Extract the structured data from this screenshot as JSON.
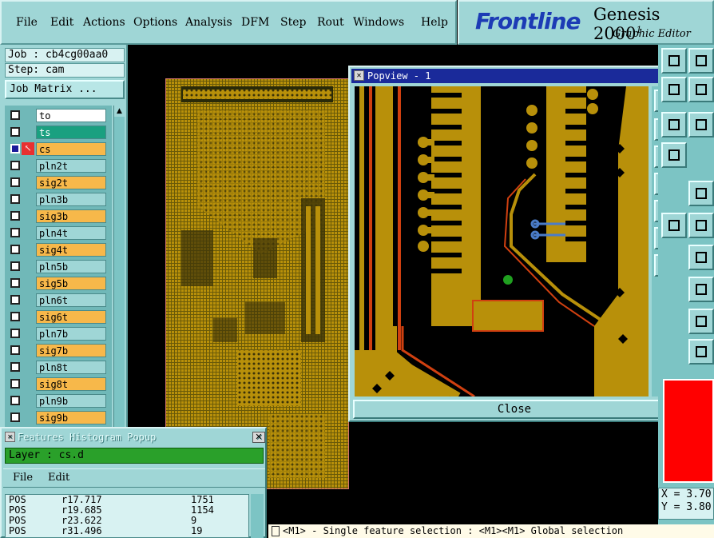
{
  "menubar": {
    "items": [
      "File",
      "Edit",
      "Actions",
      "Options",
      "Analysis",
      "DFM",
      "Step",
      "Rout",
      "Windows",
      "Help"
    ]
  },
  "logo": {
    "brand": "Frontline",
    "product": "Genesis 2000",
    "version_mark": "1",
    "subtitle": "Graphic Editor"
  },
  "job": {
    "job_label": "Job : cb4cg00aa0",
    "step_label": "Step: cam",
    "matrix_button": "Job Matrix ..."
  },
  "layers": [
    {
      "name": "to",
      "type": "to",
      "checked": false,
      "arrow": false
    },
    {
      "name": "ts",
      "type": "ts",
      "checked": false,
      "arrow": false
    },
    {
      "name": "cs",
      "type": "cs",
      "checked": true,
      "arrow": true
    },
    {
      "name": "pln2t",
      "type": "pln",
      "checked": false,
      "arrow": false
    },
    {
      "name": "sig2t",
      "type": "sig",
      "checked": false,
      "arrow": false
    },
    {
      "name": "pln3b",
      "type": "pln",
      "checked": false,
      "arrow": false
    },
    {
      "name": "sig3b",
      "type": "sig",
      "checked": false,
      "arrow": false
    },
    {
      "name": "pln4t",
      "type": "pln",
      "checked": false,
      "arrow": false
    },
    {
      "name": "sig4t",
      "type": "sig",
      "checked": false,
      "arrow": false
    },
    {
      "name": "pln5b",
      "type": "pln",
      "checked": false,
      "arrow": false
    },
    {
      "name": "sig5b",
      "type": "sig",
      "checked": false,
      "arrow": false
    },
    {
      "name": "pln6t",
      "type": "pln",
      "checked": false,
      "arrow": false
    },
    {
      "name": "sig6t",
      "type": "sig",
      "checked": false,
      "arrow": false
    },
    {
      "name": "pln7b",
      "type": "pln",
      "checked": false,
      "arrow": false
    },
    {
      "name": "sig7b",
      "type": "sig",
      "checked": false,
      "arrow": false
    },
    {
      "name": "pln8t",
      "type": "pln",
      "checked": false,
      "arrow": false
    },
    {
      "name": "sig8t",
      "type": "sig",
      "checked": false,
      "arrow": false
    },
    {
      "name": "pln9b",
      "type": "pln",
      "checked": false,
      "arrow": false
    },
    {
      "name": "sig9b",
      "type": "sig",
      "checked": false,
      "arrow": false
    }
  ],
  "popview": {
    "title": "Popview - 1",
    "close_label": "Close"
  },
  "histogram": {
    "title": "Features Histogram Popup",
    "layer_label": "Layer :  cs.d",
    "menus": [
      "File",
      "Edit"
    ],
    "rows": [
      {
        "pol": "POS",
        "sym": "r17.717",
        "count": "1751"
      },
      {
        "pol": "POS",
        "sym": "r19.685",
        "count": "1154"
      },
      {
        "pol": "POS",
        "sym": "r23.622",
        "count": "9"
      },
      {
        "pol": "POS",
        "sym": "r31.496",
        "count": "19"
      }
    ]
  },
  "coords": {
    "x": "X = 3.70",
    "y": "Y = 3.80"
  },
  "status": {
    "message": "<M1> - Single feature selection : <M1><M1> Global selection"
  },
  "colors": {
    "panel": "#9fd6d6",
    "copper": "#b8900a",
    "signal_layer": "#f7b84a",
    "title_active": "#1a2a9a"
  }
}
